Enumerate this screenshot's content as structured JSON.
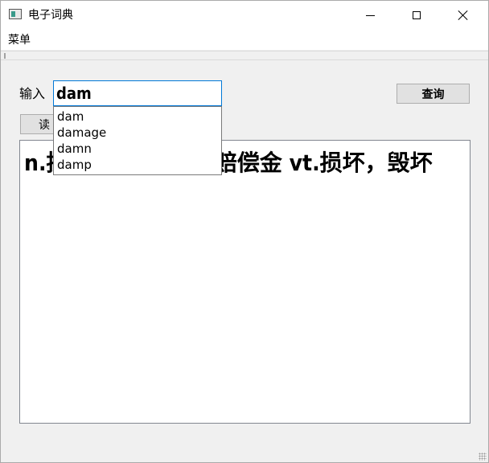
{
  "window": {
    "title": "电子词典"
  },
  "menubar": {
    "menu_label": "菜单"
  },
  "search": {
    "label": "输入",
    "value": "dam",
    "query_label": "查询",
    "read_label": "读"
  },
  "suggestions": {
    "items": [
      "dam",
      "damage",
      "damn",
      "damp"
    ]
  },
  "result": {
    "text": "n.损失，损害;(pl.)赔偿金 vt.损坏，毁坏"
  },
  "colors": {
    "focus_border": "#0078d7",
    "app_icon_accent": "#3a9a8a"
  }
}
